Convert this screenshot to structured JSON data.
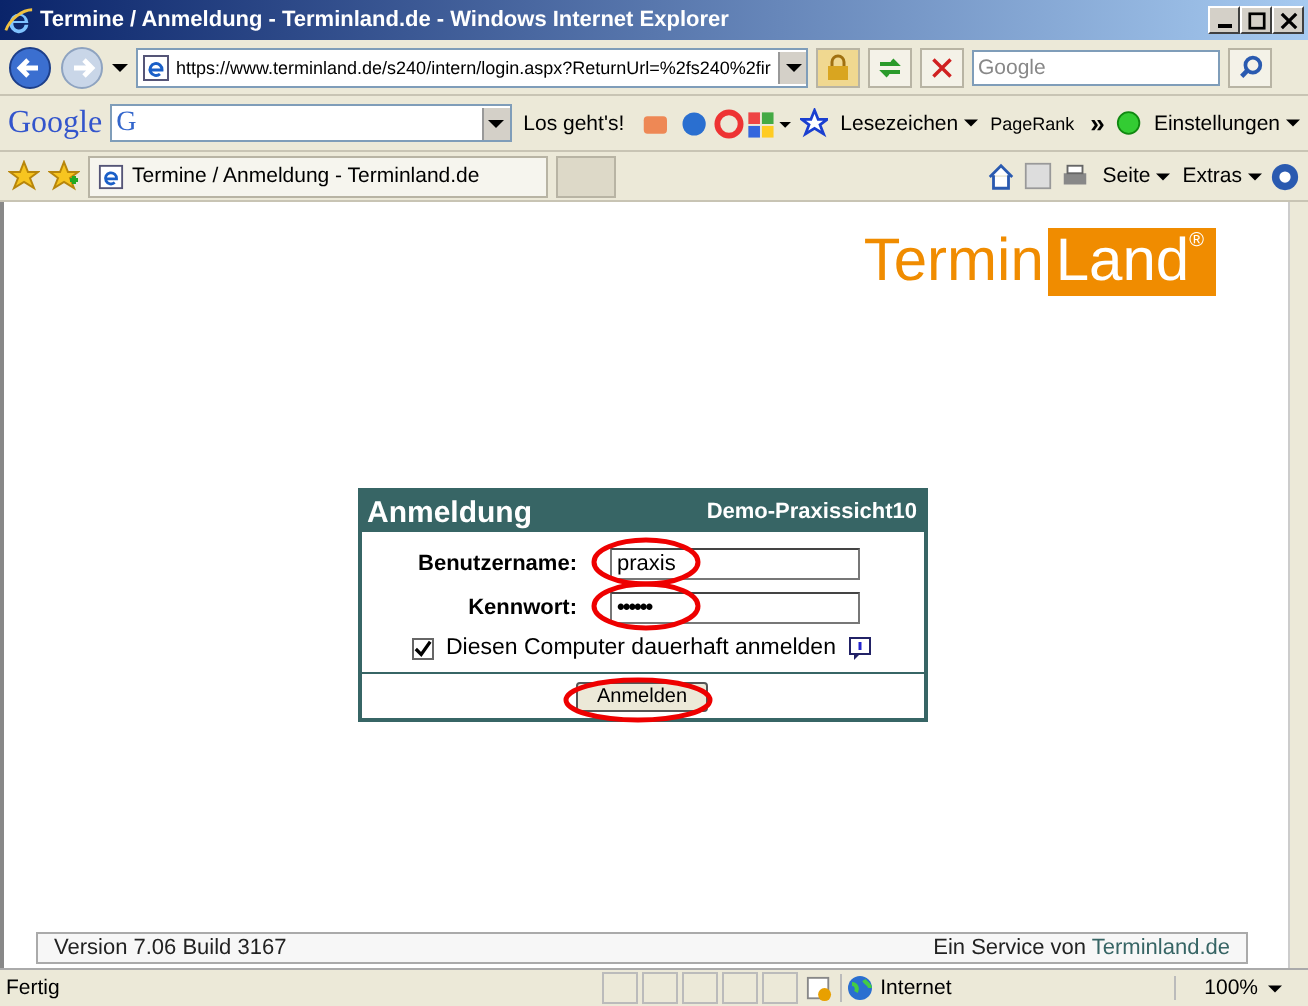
{
  "window": {
    "title": "Termine / Anmeldung - Terminland.de - Windows Internet Explorer"
  },
  "address": {
    "url": "https://www.terminland.de/s240/intern/login.aspx?ReturnUrl=%2fs240%2fir"
  },
  "search": {
    "placeholder": "Google"
  },
  "google_toolbar": {
    "logo": "Google",
    "field_icon": "G",
    "go": "Los geht's!",
    "bookmarks": "Lesezeichen",
    "pagerank": "PageRank",
    "more": "»",
    "settings": "Einstellungen"
  },
  "tab": {
    "title": "Termine / Anmeldung - Terminland.de"
  },
  "command_bar": {
    "page": "Seite",
    "tools": "Extras"
  },
  "logo": {
    "part_1": "Termin",
    "part_2": "Land",
    "mark": "®"
  },
  "login": {
    "title": "Anmeldung",
    "subtitle": "Demo-Praxissicht10",
    "fields": [
      {
        "label": "Benutzername:",
        "value": "praxis",
        "kind": "text",
        "highlighted": true
      },
      {
        "label": "Kennwort:",
        "value": "••••••",
        "kind": "password",
        "highlighted": true
      }
    ],
    "remember": {
      "label": "Diesen Computer dauerhaft anmelden",
      "checked": true
    },
    "button": {
      "label": "Anmelden",
      "highlighted": true
    }
  },
  "footer": {
    "version": "Version 7.06 Build 3167",
    "service": "Ein Service von",
    "link": "Terminland.de"
  },
  "status_bar": {
    "text": "Fertig",
    "zone": "Internet",
    "zoom": "100%"
  }
}
